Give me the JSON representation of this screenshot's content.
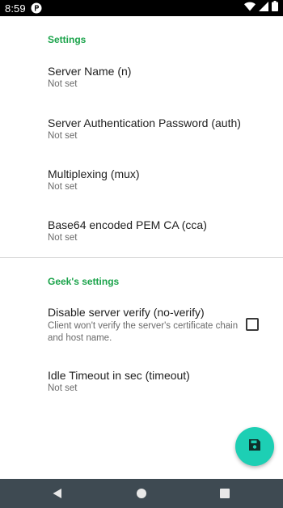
{
  "status_bar": {
    "time": "8:59",
    "icons": [
      "notification-p-icon",
      "wifi-icon",
      "signal-icon",
      "battery-icon"
    ]
  },
  "sections": [
    {
      "header": "Settings",
      "items": [
        {
          "title": "Server Name (n)",
          "summary": "Not set"
        },
        {
          "title": "Server Authentication Password (auth)",
          "summary": "Not set"
        },
        {
          "title": "Multiplexing (mux)",
          "summary": "Not set"
        },
        {
          "title": "Base64 encoded PEM CA (cca)",
          "summary": "Not set"
        }
      ]
    },
    {
      "header": "Geek's settings",
      "items": [
        {
          "title": "Disable server verify (no-verify)",
          "summary": "Client won't verify the server's certificate chain and host name.",
          "checked": false
        },
        {
          "title": "Idle Timeout in sec (timeout)",
          "summary": "Not set"
        }
      ]
    }
  ],
  "fab": {
    "icon": "save-icon"
  },
  "nav_bar": {
    "buttons": [
      "back-icon",
      "home-icon",
      "recents-icon"
    ]
  },
  "colors": {
    "accent": "#1aa34a",
    "fab": "#1dcfb4",
    "nav_bar": "#3e4a52",
    "status_bar": "#000000"
  }
}
